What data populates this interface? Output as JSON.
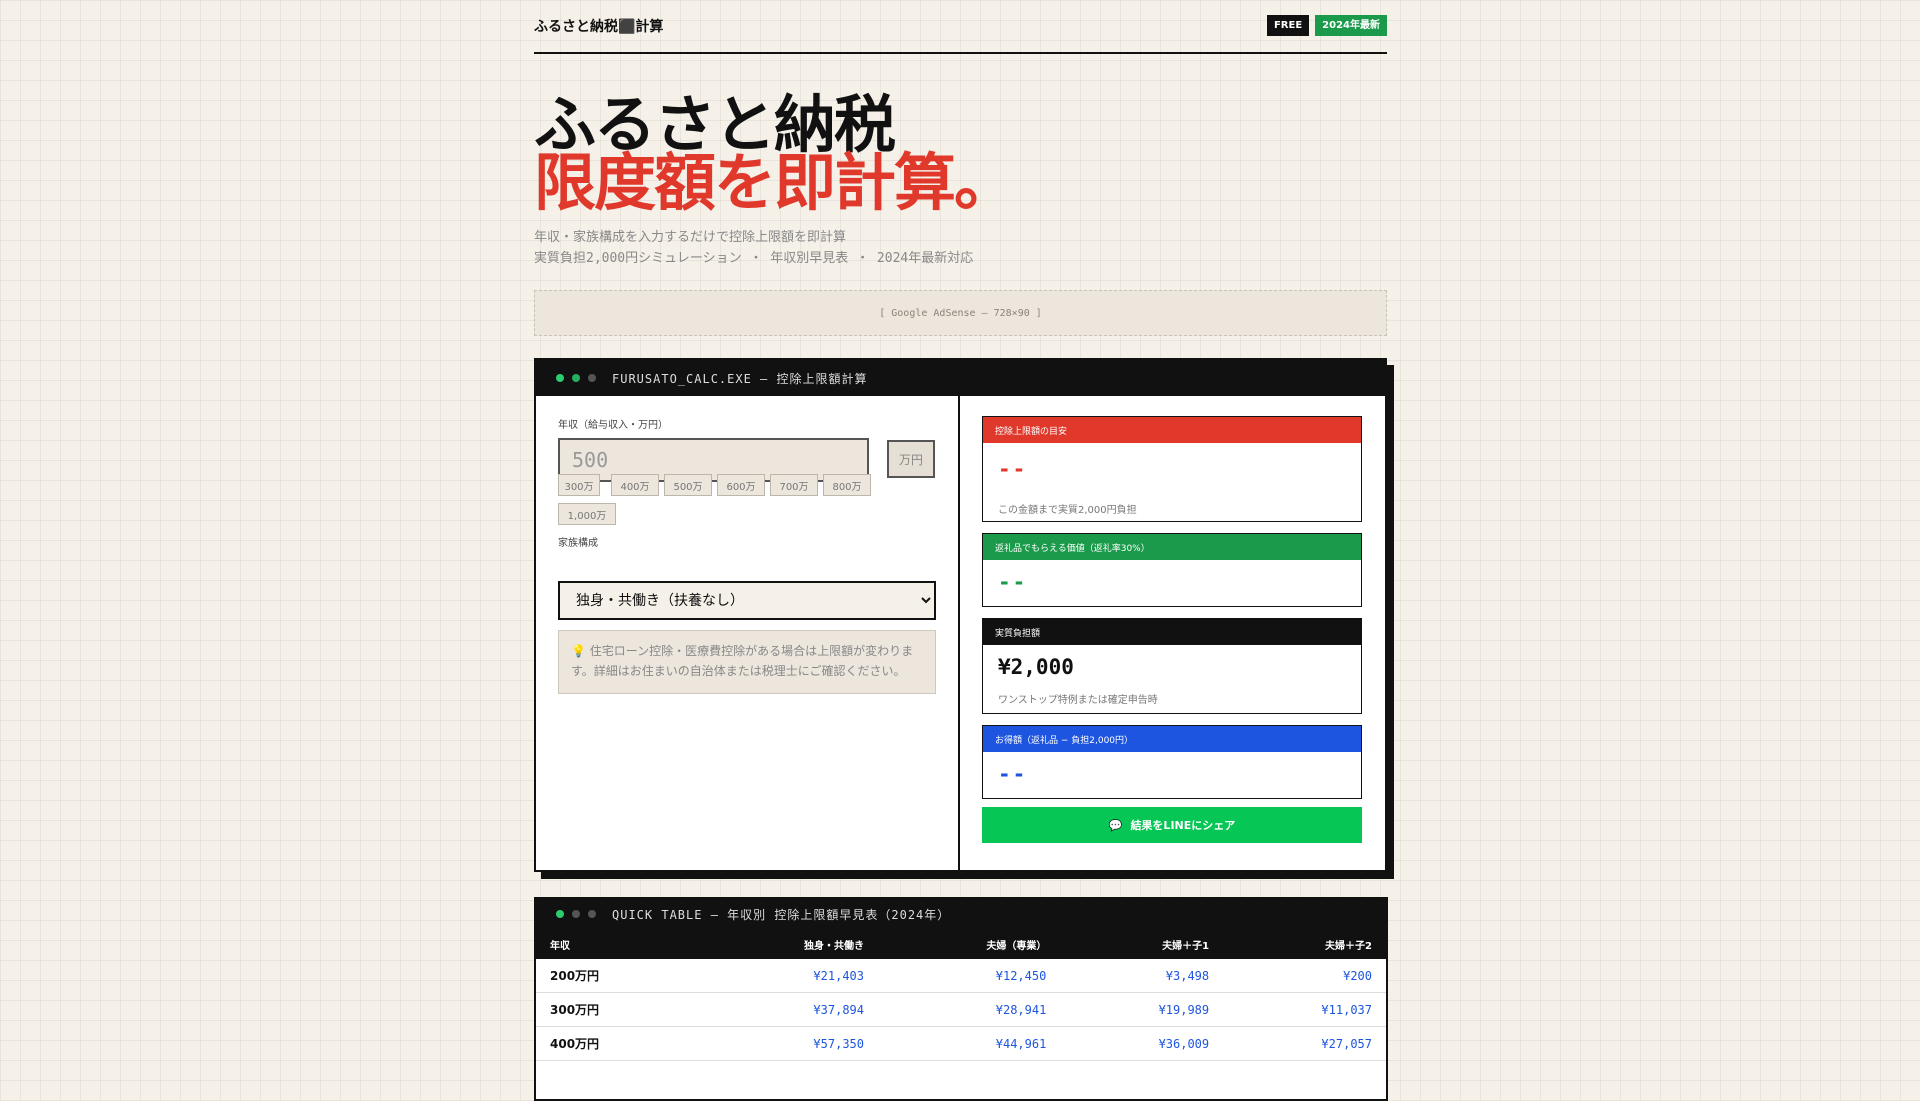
{
  "header": {
    "site_title": "ふるさと納税⬛計算",
    "badge_free": "FREE",
    "badge_year": "2024年最新"
  },
  "hero": {
    "line1": "ふるさと納税",
    "line2": "限度額を即計算。",
    "sub1": "年収・家族構成を入力するだけで控除上限額を即計算",
    "sub2": "実質負担2,000円シミュレーション ・ 年収別早見表 ・ 2024年最新対応"
  },
  "ad": {
    "label": "[ Google AdSense — 728×90 ]"
  },
  "calc": {
    "title": "FURUSATO_CALC.EXE — 控除上限額計算",
    "income_label": "年収（給与収入・万円）",
    "income_placeholder": "500",
    "income_unit": "万円",
    "quick_chips": [
      "300万",
      "400万",
      "500万",
      "600万",
      "700万",
      "800万",
      "1,000万"
    ],
    "family_label": "家族構成",
    "family_selected": "独身・共働き（扶養なし）",
    "note": "💡 住宅ローン控除・医療費控除がある場合は上限額が変わります。詳細はお住まいの自治体または税理士にご確認ください。",
    "results": {
      "limit": {
        "title": "控除上限額の目安",
        "value": "--",
        "sub": "この金額まで実質2,000円負担",
        "color": "#e0392b"
      },
      "gift": {
        "title": "返礼品でもらえる価値（返礼率30%）",
        "value": "--",
        "color": "#1a9a4a"
      },
      "burden": {
        "title": "実質負担額",
        "value": "¥2,000",
        "sub": "ワンストップ特例または確定申告時",
        "color": "#111111"
      },
      "profit": {
        "title": "お得額（返礼品 − 負担2,000円）",
        "value": "--",
        "color": "#1e55e0"
      }
    },
    "share_label": "結果をLINEにシェア"
  },
  "quick_table": {
    "title": "QUICK TABLE — 年収別 控除上限額早見表（2024年）",
    "headers": [
      "年収",
      "独身・共働き",
      "夫婦（専業）",
      "夫婦＋子1",
      "夫婦＋子2"
    ],
    "rows": [
      [
        "200万円",
        "¥21,403",
        "¥12,450",
        "¥3,498",
        "¥200"
      ],
      [
        "300万円",
        "¥37,894",
        "¥28,941",
        "¥19,989",
        "¥11,037"
      ],
      [
        "400万円",
        "¥57,350",
        "¥44,961",
        "¥36,009",
        "¥27,057"
      ]
    ]
  }
}
